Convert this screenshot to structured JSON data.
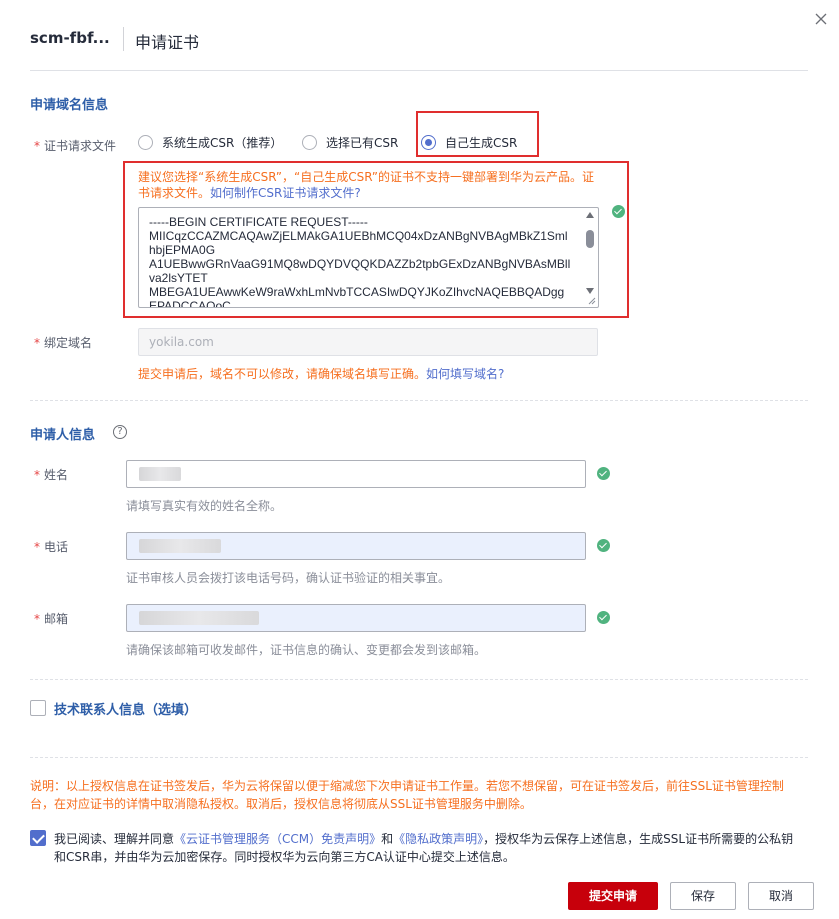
{
  "header": {
    "name": "scm-fbf...",
    "title": "申请证书"
  },
  "domain_section": {
    "title": "申请域名信息",
    "csr_label": "证书请求文件",
    "radio_options": [
      "系统生成CSR（推荐）",
      "选择已有CSR",
      "自己生成CSR"
    ],
    "selected_option": "自己生成CSR",
    "warning_text": "建议您选择“系统生成CSR”，“自己生成CSR”的证书不支持一键部署到华为云产品。证书请求文件。",
    "warning_link": "如何制作CSR证书请求文件?",
    "csr_value": "-----BEGIN CERTIFICATE REQUEST-----\nMIICqzCCAZMCAQAwZjELMAkGA1UEBhMCQ04xDzANBgNVBAgMBkZ1Sml\nhbjEPMA0G\nA1UEBwwGRnVaaG91MQ8wDQYDVQQKDAZZb2tpbGExDzANBgNVBAsMBll\nva2lsYTET\nMBEGA1UEAwwKeW9raWxhLmNvbTCCASIwDQYJKoZIhvcNAQEBBQADgg\nEPADCCAQoC",
    "domain_label": "绑定域名",
    "domain_placeholder": "yokila.com",
    "domain_hint": "提交申请后，域名不可以修改，请确保域名填写正确。",
    "domain_hint_link": "如何填写域名?"
  },
  "applicant_section": {
    "title": "申请人信息",
    "help_icon": "?",
    "name_label": "姓名",
    "name_hint": "请填写真实有效的姓名全称。",
    "phone_label": "电话",
    "phone_hint": "证书审核人员会拨打该电话号码，确认证书验证的相关事宜。",
    "email_label": "邮箱",
    "email_hint": "请确保该邮箱可收发邮件，证书信息的确认、变更都会发到该邮箱。"
  },
  "tech_contact": {
    "label": "技术联系人信息（选填）",
    "checked": false
  },
  "note": "说明：以上授权信息在证书签发后，华为云将保留以便于缩减您下次申请证书工作量。若您不想保留，可在证书签发后，前往SSL证书管理控制台，在对应证书的详情中取消隐私授权。取消后，授权信息将彻底从SSL证书管理服务中删除。",
  "agreement": {
    "checked": true,
    "prefix": "我已阅读、理解并同意",
    "link1": "《云证书管理服务（CCM）免责声明》",
    "and": "和",
    "link2": "《隐私政策声明》",
    "suffix": "，授权华为云保存上述信息，生成SSL证书所需要的公私钥和CSR串，并由华为云加密保存。同时授权华为云向第三方CA认证中心提交上述信息。"
  },
  "buttons": {
    "submit": "提交申请",
    "save": "保存",
    "cancel": "取消"
  },
  "colors": {
    "primary": "#c7000b",
    "link": "#526ecc",
    "warning": "#f66f1f",
    "success": "#50b37f",
    "section_title": "#2e5ea8"
  }
}
